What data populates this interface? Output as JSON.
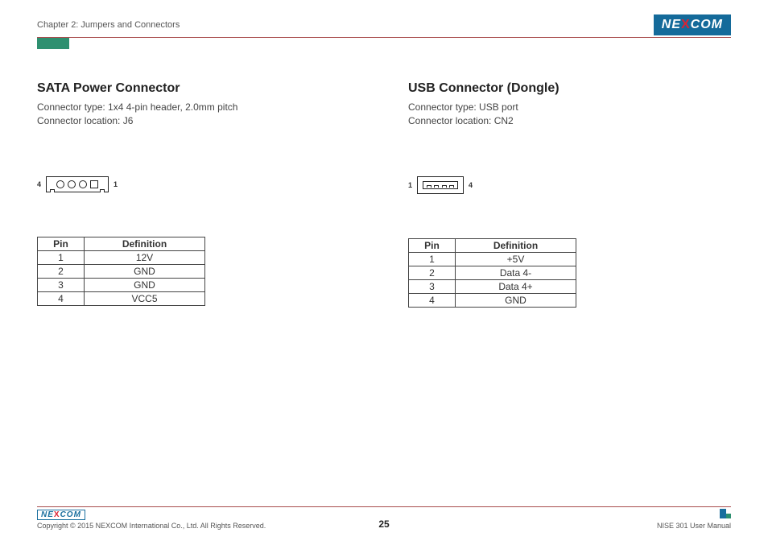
{
  "header": {
    "chapter": "Chapter 2: Jumpers and Connectors",
    "logo_text_pre": "NE",
    "logo_text_x": "X",
    "logo_text_post": "COM"
  },
  "left": {
    "title": "SATA Power Connector",
    "line1": "Connector type: 1x4 4-pin header, 2.0mm pitch",
    "line2": "Connector location: J6",
    "pin_left": "4",
    "pin_right": "1",
    "th_pin": "Pin",
    "th_def": "Definition",
    "rows": [
      {
        "pin": "1",
        "def": "12V"
      },
      {
        "pin": "2",
        "def": "GND"
      },
      {
        "pin": "3",
        "def": "GND"
      },
      {
        "pin": "4",
        "def": "VCC5"
      }
    ]
  },
  "right": {
    "title": "USB Connector (Dongle)",
    "line1": "Connector type: USB port",
    "line2": "Connector location: CN2",
    "pin_left": "1",
    "pin_right": "4",
    "th_pin": "Pin",
    "th_def": "Definition",
    "rows": [
      {
        "pin": "1",
        "def": "+5V"
      },
      {
        "pin": "2",
        "def": "Data 4-"
      },
      {
        "pin": "3",
        "def": "Data 4+"
      },
      {
        "pin": "4",
        "def": "GND"
      }
    ]
  },
  "footer": {
    "copyright": "Copyright © 2015 NEXCOM International Co., Ltd. All Rights Reserved.",
    "page": "25",
    "manual": "NISE 301 User Manual",
    "logo_pre": "NE",
    "logo_x": "X",
    "logo_post": "COM"
  }
}
